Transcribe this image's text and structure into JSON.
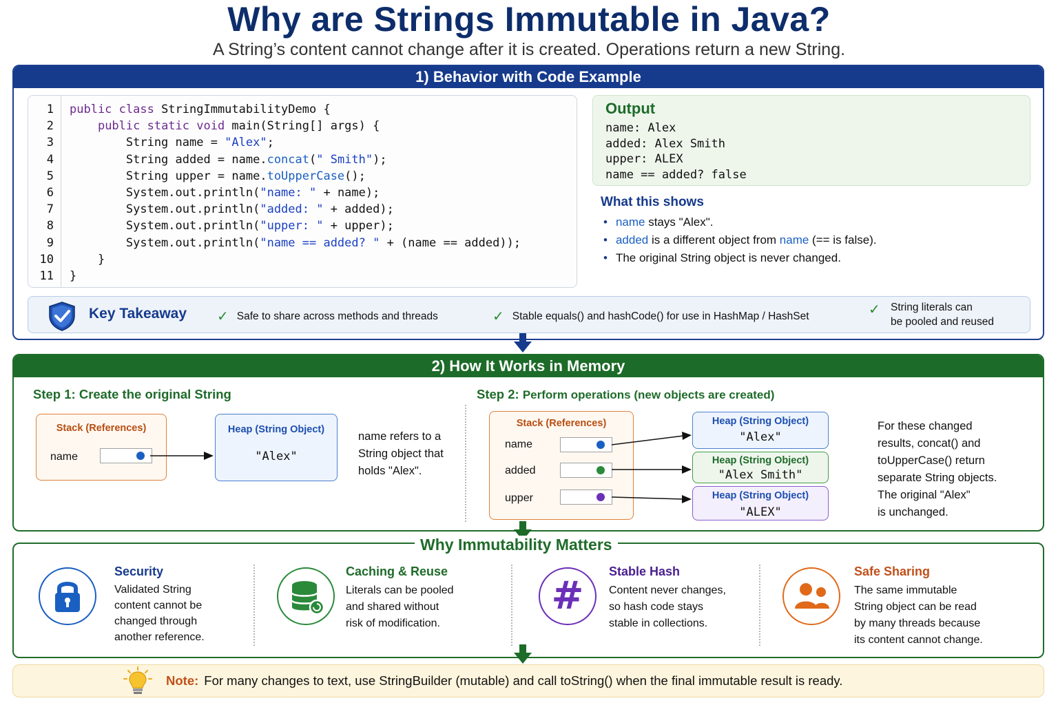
{
  "title": "Why are Strings Immutable in Java?",
  "subtitle": "A String’s content cannot change after it is created. Operations return a new String.",
  "section1": {
    "header": "1) Behavior with Code Example",
    "line_numbers": [
      "1",
      "2",
      "3",
      "4",
      "5",
      "6",
      "7",
      "8",
      "9",
      "10",
      "11"
    ],
    "code": {
      "l1_kw": "public class",
      "l1_rest": " StringImmutabilityDemo {",
      "l2_indent": "    ",
      "l2_kw": "public static void",
      "l2_rest": " main(String[] args) {",
      "l3_a": "        String name = ",
      "l3_str": "\"Alex\"",
      "l3_b": ";",
      "l4_a": "        String added = name.",
      "l4_fn": "concat",
      "l4_b": "(",
      "l4_str": "\" Smith\"",
      "l4_c": ");",
      "l5_a": "        String upper = name.",
      "l5_fn": "toUpperCase",
      "l5_b": "();",
      "l6_a": "        System.out.println(",
      "l6_str": "\"name: \"",
      "l6_b": " + name);",
      "l7_a": "        System.out.println(",
      "l7_str": "\"added: \"",
      "l7_b": " + added);",
      "l8_a": "        System.out.println(",
      "l8_str": "\"upper: \"",
      "l8_b": " + upper);",
      "l9_a": "        System.out.println(",
      "l9_str": "\"name == added? \"",
      "l9_b": " + (name == added));",
      "l10": "    }",
      "l11": "}"
    },
    "output": {
      "title": "Output",
      "lines": [
        "name: Alex",
        "added: Alex Smith",
        "upper: ALEX",
        "name == added? false"
      ]
    },
    "shows": {
      "title": "What this shows",
      "b1_ref": "name",
      "b1_text": " stays \"Alex\".",
      "b2_ref": "added",
      "b2_text_a": " is a different object from ",
      "b2_ref2": "name",
      "b2_text_b": " (== is false).",
      "b3_text": "The original String object is never changed.",
      "bullet": "•"
    },
    "takeaway": {
      "title": "Key Takeaway",
      "check": "✓",
      "items": [
        "Safe to share across methods and threads",
        "Stable equals() and hashCode() for use in HashMap / HashSet",
        "String literals can",
        "be pooled and reused"
      ]
    }
  },
  "section2": {
    "header": "2) How It Works in Memory",
    "step1_label": "Step 1:",
    "step1_title": "Create the original String",
    "step2_label": "Step 2:",
    "step2_title": "Perform operations (new objects are created)",
    "stack_label": "Stack (References)",
    "heap_label": "Heap (String Object)",
    "step1_var": "name",
    "step1_heap_value": "\"Alex\"",
    "step1_note": [
      "name refers to a",
      "String object that",
      "holds \"Alex\"."
    ],
    "step2_vars": [
      "name",
      "added",
      "upper"
    ],
    "step2_heap_values": [
      "\"Alex\"",
      "\"Alex Smith\"",
      "\"ALEX\""
    ],
    "step2_note": [
      "For these changed",
      "results, concat() and",
      "toUpperCase() return",
      "separate String objects.",
      "The original \"Alex\"",
      "is unchanged."
    ]
  },
  "section3": {
    "title": "Why Immutability Matters",
    "cards": [
      {
        "title": "Security",
        "lines": [
          "Validated String",
          "content cannot be",
          "changed through",
          "another reference."
        ],
        "icon": "lock-icon",
        "color": "#1a5fc2"
      },
      {
        "title": "Caching & Reuse",
        "lines": [
          "Literals can be pooled",
          "and shared without",
          "risk of modification."
        ],
        "icon": "database-icon",
        "color": "#2a8a3a"
      },
      {
        "title": "Stable Hash",
        "lines": [
          "Content never changes,",
          "so hash code stays",
          "stable in collections."
        ],
        "icon": "hash-icon",
        "color": "#6b2fb8"
      },
      {
        "title": "Safe Sharing",
        "lines": [
          "The same immutable",
          "String object can be read",
          "by many threads because",
          "its content cannot change."
        ],
        "icon": "users-icon",
        "color": "#e0691a"
      }
    ],
    "hash_glyph": "#"
  },
  "note": {
    "label": "Note:",
    "text": "For many changes to text, use StringBuilder (mutable) and call toString() when the final immutable result is ready."
  },
  "colors": {
    "blue_header": "#163a8c",
    "green_header": "#1c6b28",
    "orange": "#e0803a",
    "heap_blue": "#4a7fd0",
    "heap_green": "#3f9a4a",
    "heap_purple": "#8a5cd0"
  }
}
